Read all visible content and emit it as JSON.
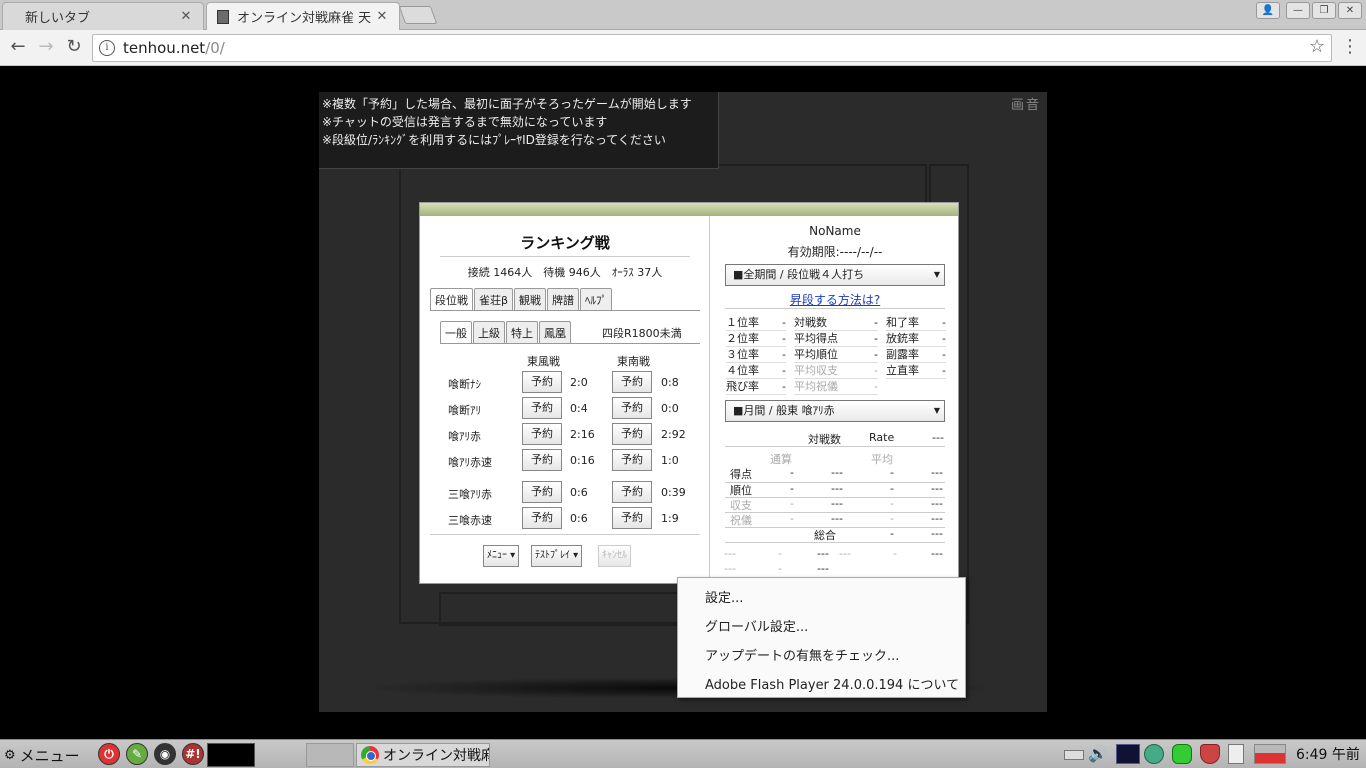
{
  "browser": {
    "tabs": [
      {
        "title": "新しいタブ",
        "active": false
      },
      {
        "title": "オンライン対戦麻雀 天",
        "active": true
      }
    ],
    "url_host": "tenhou.net",
    "url_path": "/0/",
    "window_buttons": [
      "👤",
      "—",
      "❐",
      "✕"
    ]
  },
  "notice": {
    "lines": [
      "※複数「予約」した場合、最初に面子がそろったゲームが開始します",
      "※チャットの受信は発言するまで無効になっています",
      "※段級位/ﾗﾝｷﾝｸﾞを利用するにはﾌﾟﾚｰﾔID登録を行なってください"
    ],
    "corner_icons": "画音"
  },
  "lobby": {
    "title": "ランキング戦",
    "stats": "接続 1464人　待機 946人　ｵｰﾗｽ 37人",
    "main_tabs": [
      "段位戦",
      "雀荘β",
      "観戦",
      "牌譜",
      "ﾍﾙﾌﾟ"
    ],
    "sub_tabs": [
      "一般",
      "上級",
      "特上",
      "鳳凰"
    ],
    "level_note": "四段R1800未満",
    "col_east": "東風戦",
    "col_south": "東南戦",
    "reserve_label": "予約",
    "rooms": [
      {
        "name": "喰断ﾅｼ",
        "east": "2:0",
        "south": "0:8"
      },
      {
        "name": "喰断ｱﾘ",
        "east": "0:4",
        "south": "0:0"
      },
      {
        "name": "喰ｱﾘ赤",
        "east": "2:16",
        "south": "2:92"
      },
      {
        "name": "喰ｱﾘ赤速",
        "east": "0:16",
        "south": "1:0"
      },
      {
        "name": "三喰ｱﾘ赤",
        "east": "0:6",
        "south": "0:39"
      },
      {
        "name": "三喰赤速",
        "east": "0:6",
        "south": "1:9"
      }
    ],
    "menu_btn": "ﾒﾆｭｰ ▾",
    "test_btn": "ﾃｽﾄﾌﾟﾚｲ ▾",
    "cancel_btn": "ｷｬﾝｾﾙ"
  },
  "profile": {
    "name": "NoName",
    "expiry": "有効期限:----/--/--",
    "period_select": "■全期間 / 段位戦４人打ち",
    "howto_link": "昇段する方法は?",
    "stats": [
      {
        "label": "１位率",
        "value": "-"
      },
      {
        "label": "２位率",
        "value": "-"
      },
      {
        "label": "３位率",
        "value": "-"
      },
      {
        "label": "４位率",
        "value": "-"
      },
      {
        "label": "飛び率",
        "value": "-"
      },
      {
        "label": "対戦数",
        "value": "-"
      },
      {
        "label": "平均得点",
        "value": "-"
      },
      {
        "label": "平均順位",
        "value": "-"
      },
      {
        "label": "平均収支",
        "value": "-"
      },
      {
        "label": "平均祝儀",
        "value": "-"
      },
      {
        "label": "和了率",
        "value": "-"
      },
      {
        "label": "放銃率",
        "value": "-"
      },
      {
        "label": "副露率",
        "value": "-"
      },
      {
        "label": "立直率",
        "value": "-"
      }
    ],
    "monthly_select": "■月間 / 般東 喰ｱﾘ赤",
    "monthly": {
      "h_games": "対戦数",
      "h_rate": "Rate",
      "h_rate_val": "---",
      "h_total": "通算",
      "h_avg": "平均",
      "rows": [
        {
          "label": "得点",
          "a": "-",
          "b": "---",
          "c": "-",
          "d": "---"
        },
        {
          "label": "順位",
          "a": "-",
          "b": "---",
          "c": "-",
          "d": "---"
        },
        {
          "label": "収支",
          "a": "-",
          "b": "---",
          "c": "-",
          "d": "---"
        },
        {
          "label": "祝儀",
          "a": "-",
          "b": "---",
          "c": "-",
          "d": "---"
        }
      ],
      "overall_label": "総合",
      "overall_a": "-",
      "overall_b": "---",
      "bottom_rows": [
        {
          "a": "---",
          "b": "-",
          "c": "---",
          "d": "---",
          "e": "-",
          "f": "---"
        },
        {
          "a": "---",
          "b": "-",
          "c": "---"
        }
      ]
    }
  },
  "context_menu": {
    "items": [
      "設定...",
      "グローバル設定...",
      "アップデートの有無をチェック...",
      "Adobe Flash Player 24.0.0.194  について"
    ]
  },
  "taskbar": {
    "menu_label": "メニュー",
    "window_title": "オンライン対戦麻雀 天鳳",
    "clock": "6:49 午前",
    "hash_label": "#!"
  },
  "colors": {
    "panel_bar": "#a5b27b",
    "link": "#1a3cc4",
    "flash_bg": "#2b2b2b"
  }
}
